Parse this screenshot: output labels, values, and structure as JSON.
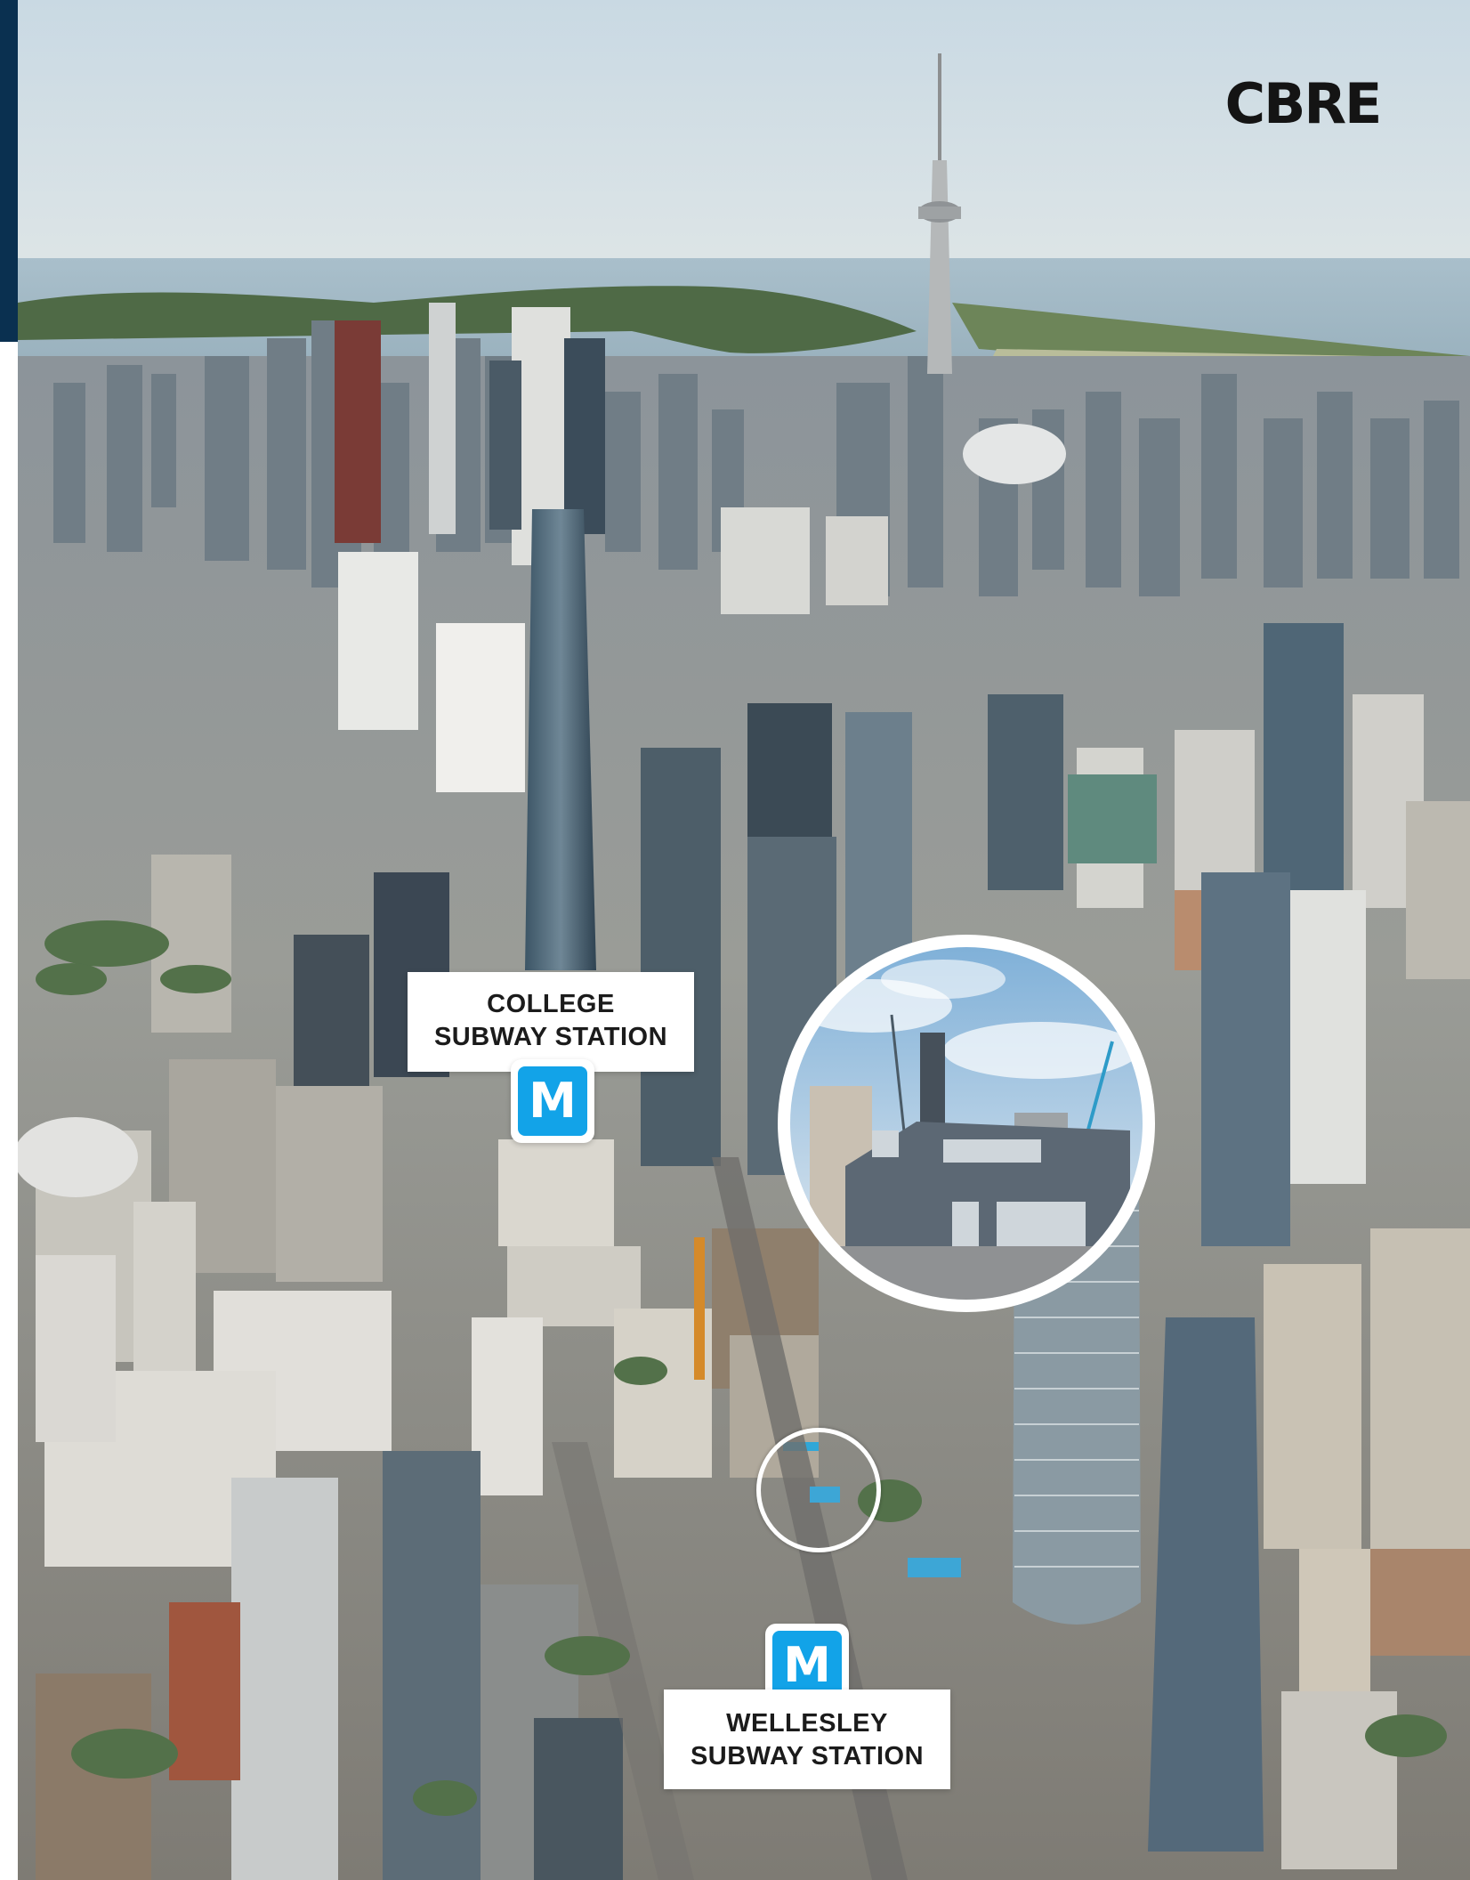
{
  "brand": {
    "logo_text": "CBRE",
    "logo_color": "#141414",
    "edge_bar_color": "#0a3050"
  },
  "photo": {
    "subject": "aerial-city-skyline-photo"
  },
  "stations": {
    "college": {
      "line1": "COLLEGE",
      "line2": "SUBWAY STATION",
      "icon_letter": "M"
    },
    "wellesley": {
      "line1": "WELLESLEY",
      "line2": "SUBWAY STATION",
      "icon_letter": "M"
    }
  },
  "colors": {
    "subway_icon": "#12a3e8",
    "label_bg": "#ffffff",
    "callout_border": "#ffffff"
  }
}
